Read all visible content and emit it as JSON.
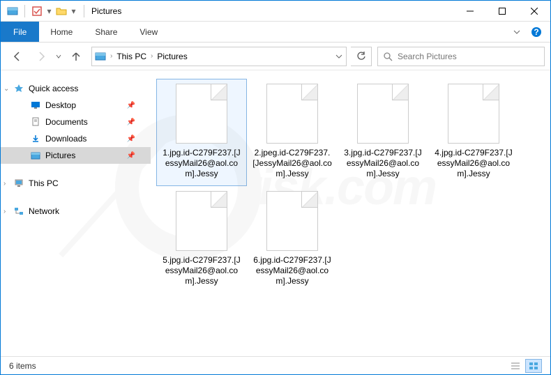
{
  "title": "Pictures",
  "ribbon": {
    "file": "File",
    "tabs": [
      "Home",
      "Share",
      "View"
    ]
  },
  "breadcrumb": {
    "root": "This PC",
    "current": "Pictures"
  },
  "search": {
    "placeholder": "Search Pictures"
  },
  "sidebar": {
    "quick": {
      "label": "Quick access",
      "items": [
        {
          "label": "Desktop",
          "pin": true
        },
        {
          "label": "Documents",
          "pin": true
        },
        {
          "label": "Downloads",
          "pin": true
        },
        {
          "label": "Pictures",
          "pin": true,
          "sel": true
        }
      ]
    },
    "thispc": {
      "label": "This PC"
    },
    "network": {
      "label": "Network"
    }
  },
  "files": [
    {
      "name": "1.jpg.id-C279F237.[JessyMail26@aol.com].Jessy",
      "sel": true
    },
    {
      "name": "2.jpeg.id-C279F237.[JessyMail26@aol.com].Jessy"
    },
    {
      "name": "3.jpg.id-C279F237.[JessyMail26@aol.com].Jessy"
    },
    {
      "name": "4.jpg.id-C279F237.[JessyMail26@aol.com].Jessy"
    },
    {
      "name": "5.jpg.id-C279F237.[JessyMail26@aol.com].Jessy"
    },
    {
      "name": "6.jpg.id-C279F237.[JessyMail26@aol.com].Jessy"
    }
  ],
  "status": {
    "count": "6 items"
  },
  "watermark": "risk.com"
}
